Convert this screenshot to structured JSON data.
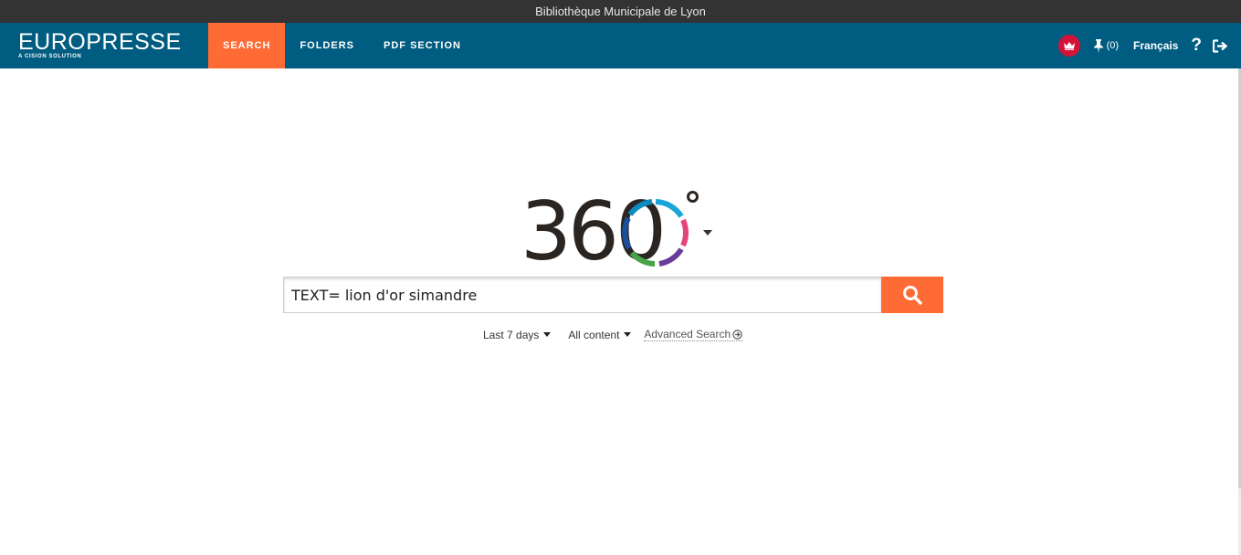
{
  "library_name": "Bibliothèque Municipale de Lyon",
  "brand": {
    "name": "EUROPRESSE",
    "tagline": "A CISION SOLUTION"
  },
  "nav": {
    "tabs": [
      {
        "label": "SEARCH",
        "active": true
      },
      {
        "label": "FOLDERS",
        "active": false
      },
      {
        "label": "PDF SECTION",
        "active": false
      }
    ]
  },
  "tools": {
    "crown_icon": "crown-icon",
    "pinned_count": "(0)",
    "language": "Français",
    "help_label": "?",
    "logout_icon": "sign-out-icon"
  },
  "search": {
    "logo_text": "360",
    "query": "TEXT= lion d'or simandre",
    "button_icon": "search-icon"
  },
  "filters": {
    "period": "Last 7 days",
    "content": "All content",
    "advanced": "Advanced Search"
  },
  "colors": {
    "navbar": "#005c80",
    "accent": "#ff6b35",
    "topbar": "#333333",
    "crown_badge": "#d3123a"
  }
}
